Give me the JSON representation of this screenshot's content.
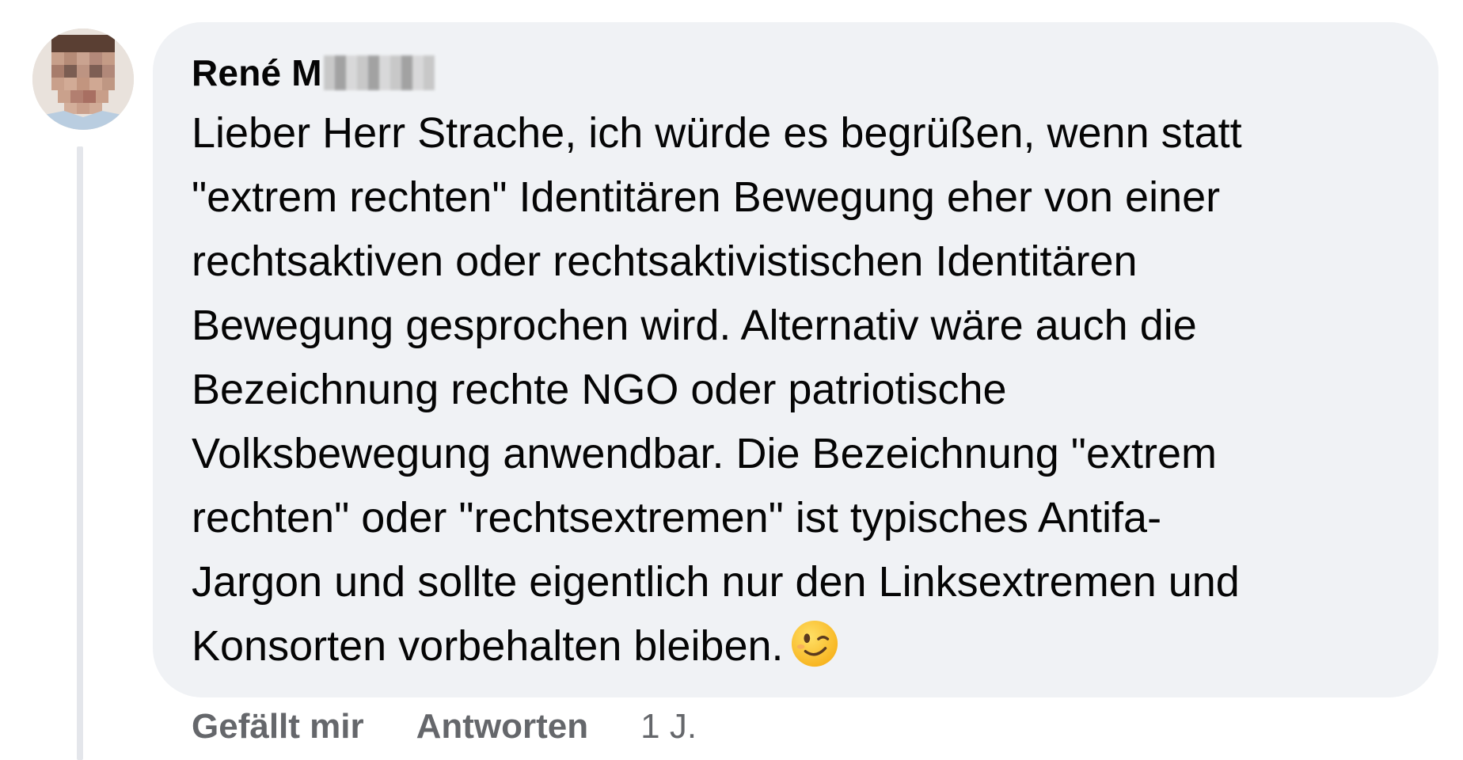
{
  "comment": {
    "author": "René M",
    "text_lines": [
      "Lieber Herr Strache, ich würde es begrüßen, wenn statt",
      "\"extrem rechten\" Identitären Bewegung eher von einer",
      "rechtsaktiven oder rechtsaktivistischen Identitären",
      "Bewegung gesprochen wird. Alternativ wäre auch die",
      "Bezeichnung rechte NGO oder patriotische",
      "Volksbewegung anwendbar. Die Bezeichnung \"extrem",
      "rechten\" oder \"rechtsextremen\" ist typisches Antifa-",
      "Jargon und sollte eigentlich nur den Linksextremen und",
      "Konsorten vorbehalten bleiben."
    ],
    "emoji": "winking-face-emoji",
    "actions": {
      "like_label": "Gefällt mir",
      "reply_label": "Antworten",
      "timestamp": "1 J."
    }
  },
  "icons": {
    "avatar": "profile-photo-pixelated",
    "emoji": "winking-face-emoji"
  },
  "colors": {
    "bubble_background": "#f0f2f5",
    "text": "#050505",
    "secondary_text": "#65676b",
    "thread_line": "#e4e6eb",
    "emoji_yellow": "#ffcc33"
  }
}
